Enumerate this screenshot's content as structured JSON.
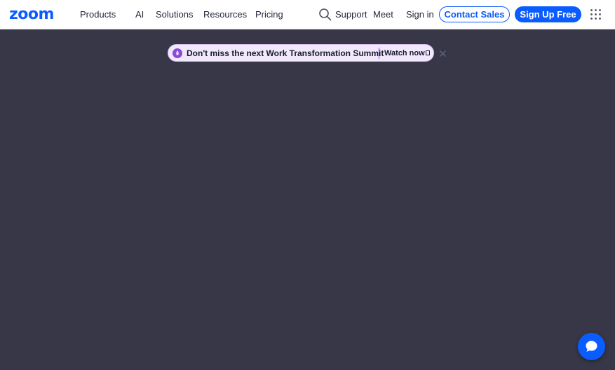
{
  "brand": {
    "logo_text": "zoom",
    "color": "#0b5cff"
  },
  "nav": {
    "left": [
      "Products",
      "AI",
      "Solutions",
      "Resources",
      "Pricing"
    ],
    "support": "Support",
    "meet": "Meet",
    "signin": "Sign in",
    "contact_sales": "Contact Sales",
    "signup": "Sign Up Free",
    "search_icon": "search-icon",
    "apps_icon": "grid-icon"
  },
  "banner": {
    "text": "Don't miss the next Work Transformation Summit",
    "link": "Watch now",
    "link_icon": "external-link-icon",
    "close_icon": "close-icon",
    "badge_icon": "rocket-icon",
    "background": "#f1e8fb"
  },
  "page": {
    "background": "#373748"
  },
  "chat": {
    "icon": "chat-icon"
  }
}
